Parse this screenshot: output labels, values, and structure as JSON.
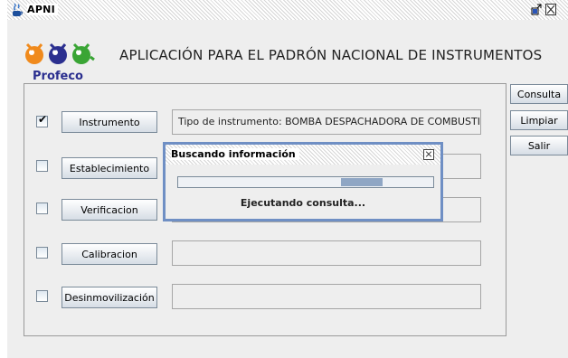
{
  "window": {
    "title": "APNI"
  },
  "header": {
    "logo_text": "Profeco",
    "app_title": "APLICACIÓN PARA EL PADRÓN NACIONAL DE INSTRUMENTOS"
  },
  "rows": [
    {
      "checked": true,
      "button": "Instrumento",
      "field": "Tipo de instrumento: BOMBA DESPACHADORA DE COMBUSTIBLE, M..."
    },
    {
      "checked": false,
      "button": "Establecimiento",
      "field": ""
    },
    {
      "checked": false,
      "button": "Verificacion",
      "field": ""
    },
    {
      "checked": false,
      "button": "Calibracion",
      "field": ""
    },
    {
      "checked": false,
      "button": "Desinmovilización",
      "field": ""
    }
  ],
  "side_buttons": {
    "consulta": "Consulta",
    "limpiar": "Limpiar",
    "salir": "Salir"
  },
  "dialog": {
    "title": "Buscando información",
    "message": "Ejecutando consulta...",
    "progress_indeterminate": true
  },
  "colors": {
    "dialog_border": "#6f8fc4",
    "logo_blue": "#2b2f8f",
    "logo_orange": "#f08a1c",
    "logo_green": "#3aa535"
  }
}
